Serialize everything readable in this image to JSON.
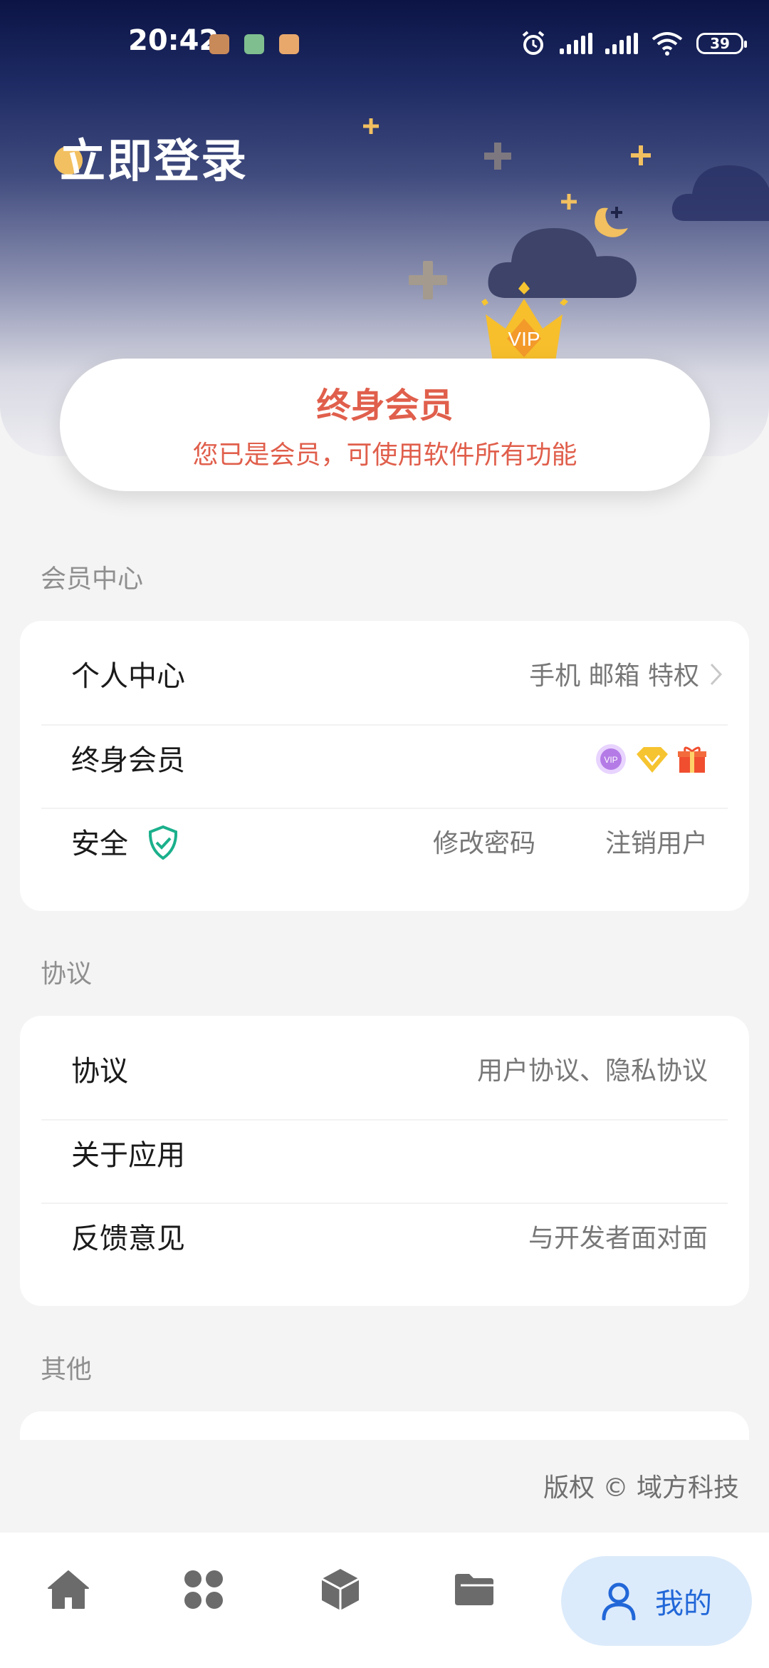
{
  "status_bar": {
    "time": "20:42",
    "battery": "39"
  },
  "header": {
    "login_title": "立即登录"
  },
  "vip_card": {
    "title": "终身会员",
    "subtitle": "您已是会员，可使用软件所有功能",
    "crown_text": "VIP"
  },
  "sections": {
    "member_center": {
      "title": "会员中心",
      "rows": {
        "personal": {
          "label": "个人中心",
          "value": "手机 邮箱 特权"
        },
        "lifetime": {
          "label": "终身会员"
        },
        "security": {
          "label": "安全",
          "value_1": "修改密码",
          "value_2": "注销用户"
        }
      }
    },
    "agreement": {
      "title": "协议",
      "rows": {
        "agreement": {
          "label": "协议",
          "value": "用户协议、隐私协议"
        },
        "about": {
          "label": "关于应用"
        },
        "feedback": {
          "label": "反馈意见",
          "value": "与开发者面对面"
        }
      }
    },
    "other": {
      "title": "其他"
    }
  },
  "copyright": "版权 © 域方科技",
  "bottom_nav": {
    "active_label": "我的"
  },
  "colors": {
    "accent_red": "#e05f4c",
    "nav_active_bg": "#dcebfb",
    "nav_active_text": "#2167d8",
    "shield": "#1bb08c"
  }
}
